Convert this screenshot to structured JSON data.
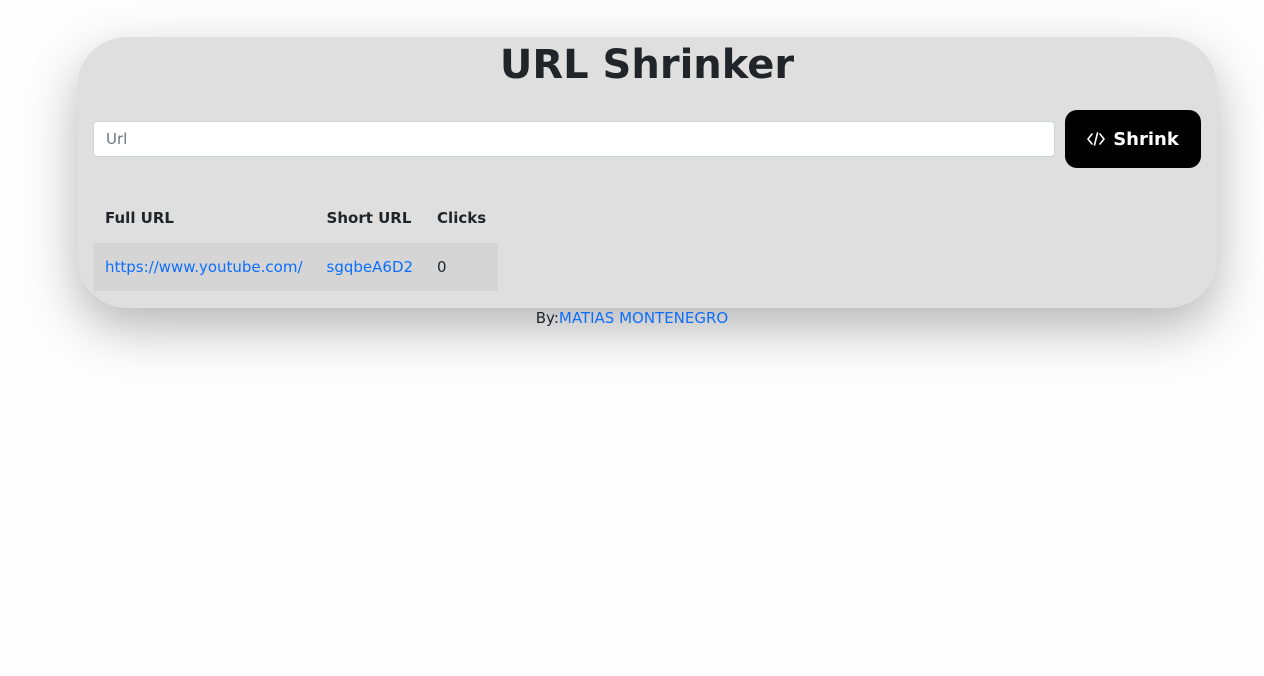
{
  "app": {
    "title": "URL Shrinker"
  },
  "form": {
    "input_placeholder": "Url",
    "input_value": "",
    "shrink_label": "Shrink",
    "shrink_icon": "code-icon",
    "button_color": "#000000"
  },
  "table": {
    "headers": [
      "Full URL",
      "Short URL",
      "Clicks"
    ],
    "rows": [
      {
        "full_url": "https://www.youtube.com/",
        "short_url": "sgqbeA6D2",
        "clicks": "0"
      }
    ]
  },
  "footer": {
    "prefix": "By:",
    "author": "MATIAS MONTENEGRO",
    "link_color": "#0d6efd"
  },
  "colors": {
    "card_background": "#dfdfdf",
    "page_background": "#fdfdfd"
  }
}
